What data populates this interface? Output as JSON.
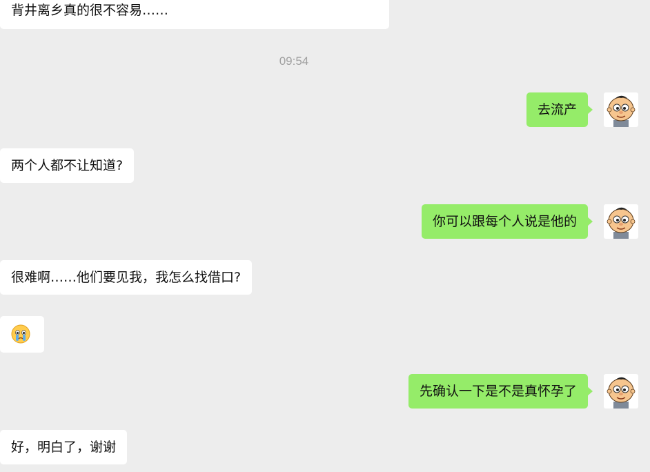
{
  "conversation": {
    "messages": [
      {
        "text": "背井离乡真的很不容易……"
      },
      {
        "text": "去流产"
      },
      {
        "text": "两个人都不让知道?"
      },
      {
        "text": "你可以跟每个人说是他的"
      },
      {
        "text": "很难啊……他们要见我，我怎么找借口?"
      },
      {
        "emoji": "crying-face-emoji"
      },
      {
        "text": "先确认一下是不是真怀孕了"
      },
      {
        "text": "好，明白了，谢谢"
      }
    ],
    "timestamp": "09:54"
  },
  "avatar": {
    "icon": "cartoon-baby-avatar"
  },
  "colors": {
    "background": "#ededed",
    "incoming_bubble": "#ffffff",
    "outgoing_bubble": "#95ec69",
    "timestamp_text": "#a0a0a0"
  }
}
